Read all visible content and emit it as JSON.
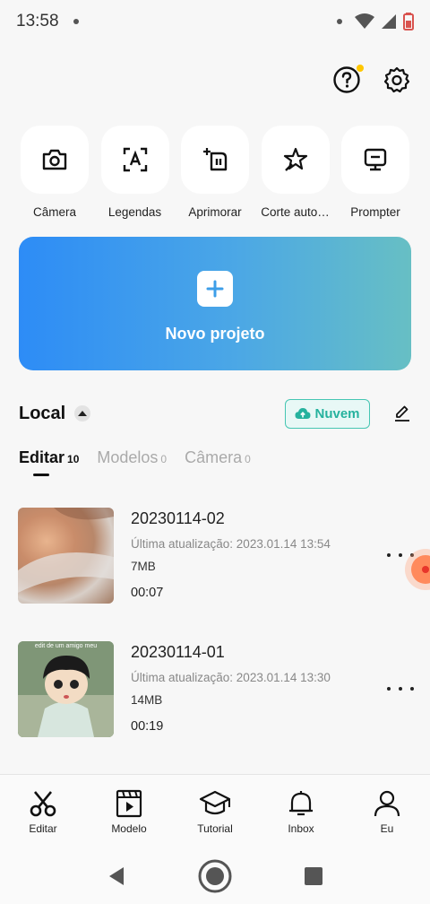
{
  "status": {
    "time": "13:58"
  },
  "quick_actions": [
    {
      "label": "Câmera",
      "icon": "camera-icon"
    },
    {
      "label": "Legendas",
      "icon": "captions-icon"
    },
    {
      "label": "Aprimorar",
      "icon": "enhance-icon"
    },
    {
      "label": "Corte auto…",
      "icon": "auto-cut-icon"
    },
    {
      "label": "Prompter",
      "icon": "prompter-icon"
    }
  ],
  "new_project": {
    "label": "Novo projeto"
  },
  "local": {
    "title": "Local",
    "cloud_label": "Nuvem"
  },
  "tabs": [
    {
      "label": "Editar",
      "count": "10",
      "active": true
    },
    {
      "label": "Modelos",
      "count": "0",
      "active": false
    },
    {
      "label": "Câmera",
      "count": "0",
      "active": false
    }
  ],
  "projects": [
    {
      "name": "20230114-02",
      "updated": "Última atualização: 2023.01.14 13:54",
      "size": "7MB",
      "duration": "00:07"
    },
    {
      "name": "20230114-01",
      "updated": "Última atualização: 2023.01.14 13:30",
      "size": "14MB",
      "duration": "00:19",
      "thumb_caption": "edit de um amigo meu"
    }
  ],
  "bottom_nav": [
    {
      "label": "Editar",
      "icon": "scissors-icon"
    },
    {
      "label": "Modelo",
      "icon": "template-icon"
    },
    {
      "label": "Tutorial",
      "icon": "graduation-cap-icon"
    },
    {
      "label": "Inbox",
      "icon": "bell-icon"
    },
    {
      "label": "Eu",
      "icon": "profile-icon"
    }
  ],
  "colors": {
    "accent_teal": "#26b29e",
    "gradient_start": "#2d8cf6",
    "gradient_end": "#67bfc4",
    "notif_dot": "#ffc700"
  }
}
